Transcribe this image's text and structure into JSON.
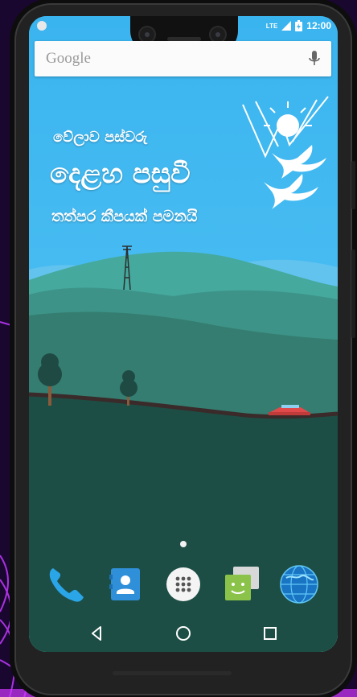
{
  "status_bar": {
    "network": "LTE",
    "time": "12:00"
  },
  "search": {
    "brand": "Google"
  },
  "banner": {
    "line1": "වේලාව පස්වරු",
    "line2": "දෙළහ පසුවී",
    "line3": "තත්පර කීපයක් පමනයි"
  },
  "dock": {
    "apps": [
      {
        "icon": "phone-icon"
      },
      {
        "icon": "contacts-icon"
      },
      {
        "icon": "app-drawer-icon"
      },
      {
        "icon": "messages-icon"
      },
      {
        "icon": "browser-globe-icon"
      }
    ]
  },
  "navigation": {
    "back": "back-icon",
    "home": "home-icon",
    "recents": "recents-icon"
  },
  "colors": {
    "sky": "#3fb6f0",
    "hill_far": "#45a99d",
    "hill_mid": "#357d70",
    "hill_near": "#1d4e45",
    "car": "#e14a4a",
    "background": "#1a0730"
  }
}
